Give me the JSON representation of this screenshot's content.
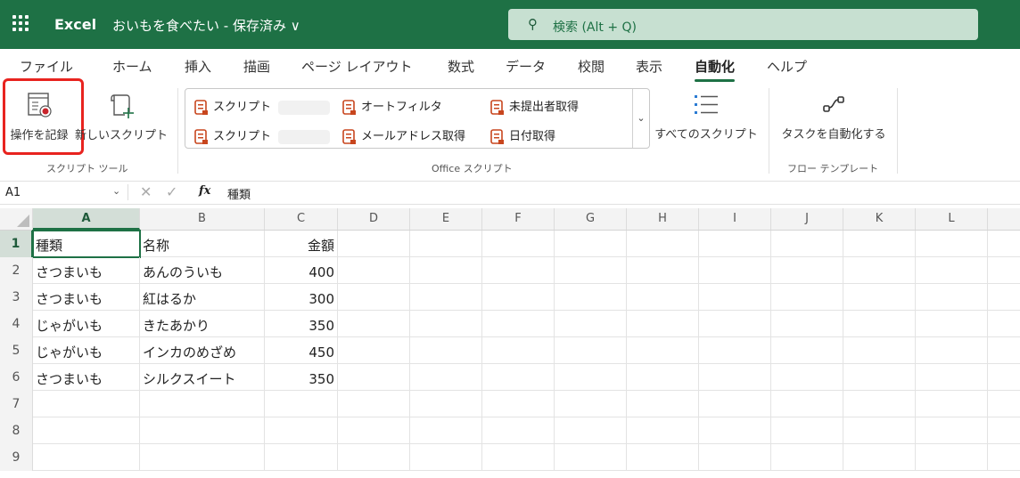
{
  "app": {
    "name": "Excel",
    "doc_title": "おいもを食べたい - 保存済み ∨"
  },
  "search": {
    "placeholder": "検索 (Alt + Q)"
  },
  "tabs": [
    "ファイル",
    "ホーム",
    "挿入",
    "描画",
    "ページ レイアウト",
    "数式",
    "データ",
    "校閲",
    "表示",
    "自動化",
    "ヘルプ"
  ],
  "active_tab": "自動化",
  "ribbon": {
    "record_label": "操作を記録",
    "new_script_label": "新しいスクリプト",
    "script_tools_label": "スクリプト ツール",
    "gallery": [
      "スクリプト",
      "オートフィルタ",
      "未提出者取得",
      "スクリプト",
      "メールアドレス取得",
      "日付取得"
    ],
    "office_scripts_label": "Office スクリプト",
    "all_scripts_label": "すべてのスクリプト",
    "automate_task_label": "タスクを自動化する",
    "flow_template_label": "フロー テンプレート"
  },
  "formula_bar": {
    "name_box": "A1",
    "value": "種類"
  },
  "columns": [
    "A",
    "B",
    "C",
    "D",
    "E",
    "F",
    "G",
    "H",
    "I",
    "J",
    "K",
    "L"
  ],
  "rows": [
    {
      "n": "1",
      "a": "種類",
      "b": "名称",
      "c": "金額"
    },
    {
      "n": "2",
      "a": "さつまいも",
      "b": "あんのういも",
      "c": "400"
    },
    {
      "n": "3",
      "a": "さつまいも",
      "b": "紅はるか",
      "c": "300"
    },
    {
      "n": "4",
      "a": "じゃがいも",
      "b": "きたあかり",
      "c": "350"
    },
    {
      "n": "5",
      "a": "じゃがいも",
      "b": "インカのめざめ",
      "c": "450"
    },
    {
      "n": "6",
      "a": "さつまいも",
      "b": "シルクスイート",
      "c": "350"
    },
    {
      "n": "7",
      "a": "",
      "b": "",
      "c": ""
    },
    {
      "n": "8",
      "a": "",
      "b": "",
      "c": ""
    },
    {
      "n": "9",
      "a": "",
      "b": "",
      "c": ""
    }
  ],
  "colors": {
    "brand": "#1e7145",
    "highlight": "#e8231f"
  }
}
